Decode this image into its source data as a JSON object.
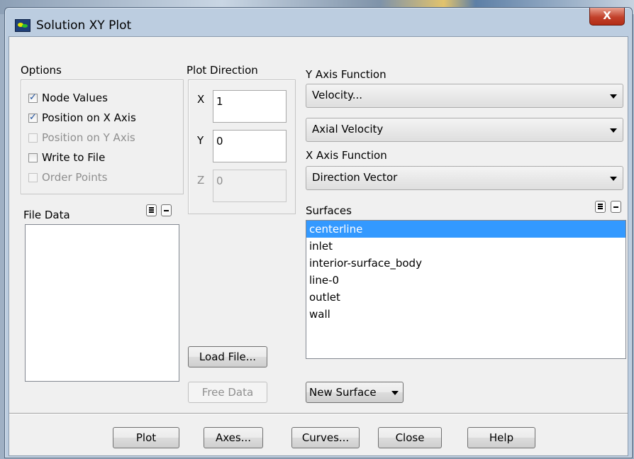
{
  "window": {
    "title": "Solution XY Plot",
    "close_glyph": "X"
  },
  "options": {
    "label": "Options",
    "items": [
      {
        "label": "Node Values",
        "checked": true,
        "enabled": true
      },
      {
        "label": "Position on X Axis",
        "checked": true,
        "enabled": true
      },
      {
        "label": "Position on Y Axis",
        "checked": false,
        "enabled": false
      },
      {
        "label": "Write to File",
        "checked": false,
        "enabled": true
      },
      {
        "label": "Order Points",
        "checked": false,
        "enabled": false
      }
    ]
  },
  "plot_direction": {
    "label": "Plot Direction",
    "x_label": "X",
    "x_value": "1",
    "y_label": "Y",
    "y_value": "0",
    "z_label": "Z",
    "z_value": "0"
  },
  "y_axis_function": {
    "label": "Y Axis Function",
    "category": "Velocity...",
    "quantity": "Axial Velocity"
  },
  "x_axis_function": {
    "label": "X Axis Function",
    "value": "Direction Vector"
  },
  "file_data": {
    "label": "File Data",
    "items": []
  },
  "surfaces": {
    "label": "Surfaces",
    "items": [
      "centerline",
      "inlet",
      "interior-surface_body",
      "line-0",
      "outlet",
      "wall"
    ],
    "selected": "centerline"
  },
  "buttons": {
    "load_file": "Load File...",
    "free_data": "Free Data",
    "new_surface": "New Surface",
    "plot": "Plot",
    "axes": "Axes...",
    "curves": "Curves...",
    "close": "Close",
    "help": "Help"
  }
}
